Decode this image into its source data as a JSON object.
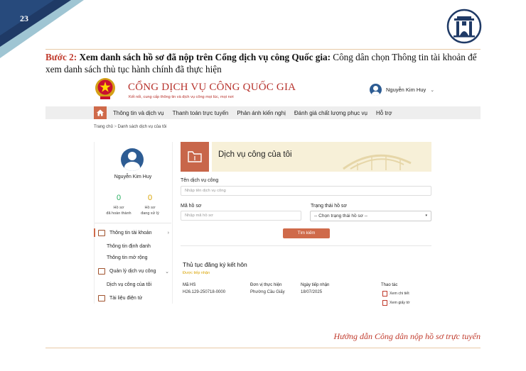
{
  "slide": {
    "number": "23",
    "instruction_step": "Bước 2:",
    "instruction_bold": " Xem danh sách hồ sơ đã nộp trên Cổng dịch vụ công Quốc gia:",
    "instruction_rest": " Công dân chọn Thông tin tài khoản để xem danh sách thủ tục hành chính đã thực hiện",
    "footer": "Hướng dẫn Công dân nộp hồ sơ trực tuyến"
  },
  "portal": {
    "title": "CỔNG DỊCH VỤ CÔNG QUỐC GIA",
    "subtitle": "Kết nối, cung cấp thông tin và dịch vụ công mọi lúc, mọi nơi",
    "user_name": "Nguyễn Kim Huy",
    "nav": [
      "Thông tin và dịch vụ",
      "Thanh toán trực tuyến",
      "Phản ánh kiến nghị",
      "Đánh giá chất lượng phục vụ",
      "Hỗ trợ"
    ],
    "breadcrumb": [
      "Trang chủ",
      "Danh sách dịch vụ của tôi"
    ]
  },
  "sidebar": {
    "name": "Nguyễn Kim Huy",
    "done_count": "0",
    "done_label_1": "Hồ sơ",
    "done_label_2": "đã hoàn thành",
    "pending_count": "0",
    "pending_label_1": "Hồ sơ",
    "pending_label_2": "đang xử lý",
    "account_info": "Thông tin tài khoản",
    "identity_info": "Thông tin định danh",
    "extended_info": "Thông tin mở rộng",
    "manage_services": "Quản lý dịch vụ công",
    "my_services": "Dịch vụ công của tôi",
    "e_documents": "Tài liệu điện tử"
  },
  "main": {
    "banner_title": "Dịch vụ công của tôi",
    "service_name_label": "Tên dịch vụ công",
    "service_name_placeholder": "Nhập tên dịch vụ công",
    "record_code_label": "Mã hồ sơ",
    "record_code_placeholder": "Nhập mã hồ sơ",
    "status_label": "Trạng thái hồ sơ",
    "status_selected": "-- Chọn trạng thái hồ sơ --",
    "search_button": "Tìm kiếm"
  },
  "record": {
    "title": "Thủ tục đăng ký kết hôn",
    "status": "Được tiếp nhận",
    "headers": [
      "Mã HS",
      "Đơn vị thực hiện",
      "Ngày tiếp nhận",
      "Thao tác"
    ],
    "code": "H26.129-250718-0000",
    "unit": "Phường Cầu Giấy",
    "date": "18/07/2025",
    "action_view": "Xem chi tiết",
    "action_paper": "Xem giấy tờ"
  },
  "colors": {
    "accent": "#cf6a4a",
    "brand_red": "#b7322c",
    "navy": "#1f3a66",
    "success": "#27ae60",
    "warning": "#d9a300"
  }
}
